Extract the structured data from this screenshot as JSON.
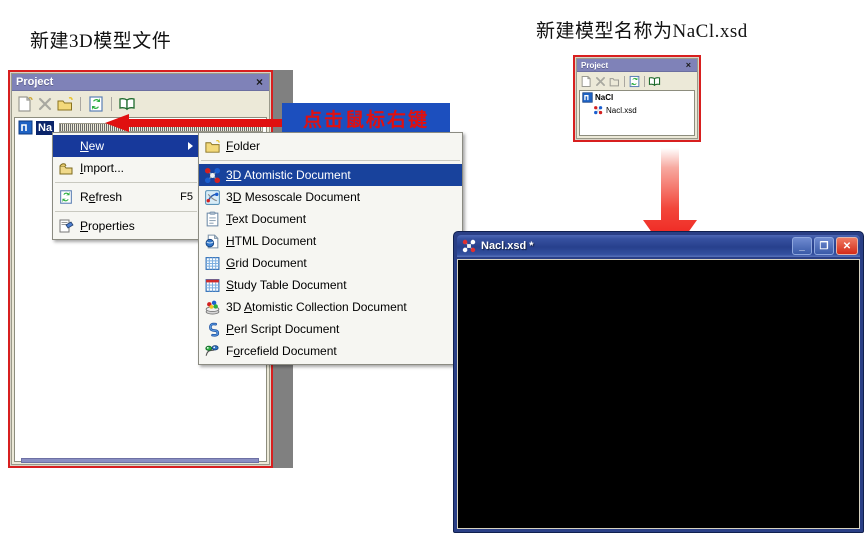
{
  "captions": {
    "left": "新建3D模型文件",
    "right": "新建模型名称为NaCl.xsd"
  },
  "callout": {
    "text": "点击鼠标右键",
    "bg_color": "#1c4fbe",
    "text_color": "#e01010"
  },
  "project_panel_left": {
    "title": "Project",
    "close_label": "×",
    "toolbar": [
      {
        "name": "new-document-icon",
        "tip": "New"
      },
      {
        "name": "delete-icon",
        "tip": "Delete"
      },
      {
        "name": "new-folder-icon",
        "tip": "New Folder"
      },
      {
        "name": "refresh-icon",
        "tip": "Refresh"
      },
      {
        "name": "open-book-icon",
        "tip": "Help"
      }
    ],
    "tree": [
      {
        "label": "Na",
        "selected": true
      }
    ]
  },
  "project_panel_right": {
    "title": "Project",
    "close_label": "×",
    "toolbar": [
      {
        "name": "new-document-icon",
        "tip": "New"
      },
      {
        "name": "delete-icon",
        "tip": "Delete"
      },
      {
        "name": "new-folder-icon",
        "tip": "New Folder"
      },
      {
        "name": "refresh-icon",
        "tip": "Refresh"
      },
      {
        "name": "open-book-icon",
        "tip": "Help"
      }
    ],
    "tree": [
      {
        "label": "NaCl",
        "icon": "project-icon",
        "bold": true
      },
      {
        "label": "Nacl.xsd",
        "icon": "atomistic-document-icon",
        "bold": false
      }
    ]
  },
  "context_menu": {
    "items": [
      {
        "label": "New",
        "underline": "N",
        "icon": "none",
        "selected": true,
        "submenu": true,
        "accel": ""
      },
      {
        "label": "Import...",
        "underline": "I",
        "icon": "import-icon",
        "selected": false,
        "submenu": false,
        "accel": ""
      },
      {
        "separator_after": true
      },
      {
        "label": "Refresh",
        "underline": "e",
        "icon": "refresh-icon",
        "selected": false,
        "submenu": false,
        "accel": "F5"
      },
      {
        "separator_after": true
      },
      {
        "label": "Properties",
        "underline": "P",
        "icon": "properties-icon",
        "selected": false,
        "submenu": false,
        "accel": ""
      }
    ]
  },
  "new_submenu": {
    "items": [
      {
        "label": "Folder",
        "underline": "F",
        "icon": "folder-icon",
        "selected": false,
        "separator_after": true
      },
      {
        "label": "3D Atomistic Document",
        "underline": "3D",
        "icon": "atomistic-document-icon",
        "selected": true,
        "separator_after": false
      },
      {
        "label": "3D Mesoscale Document",
        "underline": "D",
        "icon": "mesoscale-document-icon",
        "selected": false,
        "separator_after": false
      },
      {
        "label": "Text Document",
        "underline": "T",
        "icon": "text-document-icon",
        "selected": false,
        "separator_after": false
      },
      {
        "label": "HTML Document",
        "underline": "H",
        "icon": "html-document-icon",
        "selected": false,
        "separator_after": false
      },
      {
        "label": "Grid Document",
        "underline": "G",
        "icon": "grid-document-icon",
        "selected": false,
        "separator_after": false
      },
      {
        "label": "Study Table Document",
        "underline": "S",
        "icon": "study-table-icon",
        "selected": false,
        "separator_after": false
      },
      {
        "label": "3D Atomistic Collection Document",
        "underline": "A",
        "icon": "collection-icon",
        "selected": false,
        "separator_after": false
      },
      {
        "label": "Perl Script Document",
        "underline": "P",
        "icon": "perl-script-icon",
        "selected": false,
        "separator_after": false
      },
      {
        "label": "Forcefield Document",
        "underline": "o",
        "icon": "forcefield-icon",
        "selected": false,
        "separator_after": false
      }
    ]
  },
  "viewer_window": {
    "title": "Nacl.xsd *",
    "minimize_label": "_",
    "maximize_label": "❐",
    "close_label": "✕",
    "canvas_color": "#000000"
  },
  "arrows": {
    "left_color": "#e01010",
    "down_color": "#ee1111"
  }
}
